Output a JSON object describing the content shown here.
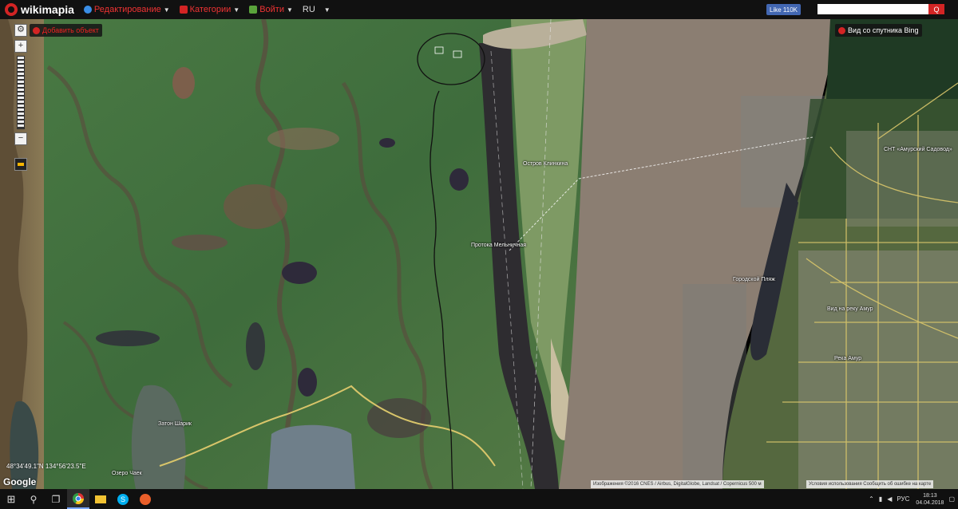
{
  "topbar": {
    "logo_text": "wikimapia",
    "nav": [
      {
        "label": "Редактирование",
        "icon": "globe-icon",
        "color": "#3a8ee6"
      },
      {
        "label": "Категории",
        "icon": "folder-icon",
        "color": "#d32424"
      },
      {
        "label": "Войти",
        "icon": "user-icon",
        "color": "#5aa33b"
      }
    ],
    "lang": "RU",
    "fb_like": "Like 110K",
    "search_placeholder": "",
    "search_button": "Q"
  },
  "map": {
    "add_object_chip": "Добавить объект",
    "satellite_chip": "Вид со спутника Bing",
    "coords": "48°34'49.1\"N 134°56'23.5\"E",
    "google": "Google",
    "attribution_left": "Изображения ©2016 CNES / Airbus, DigitalGlobe, Landsat / Copernicus   500 м",
    "attribution_right": "Условия использования   Сообщить об ошибке на карте",
    "labels": [
      {
        "text": "Остров Клинкина",
        "key": "l1"
      },
      {
        "text": "Протока Мельничная",
        "key": "l2"
      },
      {
        "text": "Затон Шарик",
        "key": "l3"
      },
      {
        "text": "Городской Пляж",
        "key": "l4"
      },
      {
        "text": "Вид на реку Амур",
        "key": "l5"
      },
      {
        "text": "Река Амур",
        "key": "l6"
      },
      {
        "text": "СНТ «Амурский Садовод»",
        "key": "l7"
      },
      {
        "text": "Озеро Чаек",
        "key": "l8"
      }
    ]
  },
  "taskbar": {
    "tray_lang": "РУС",
    "time": "18:13",
    "date": "04.04.2018"
  },
  "colors": {
    "brand": "#d32424",
    "river": "#8a7c6e",
    "vegetation": "#3c6b3a",
    "road": "#d8c56a"
  }
}
